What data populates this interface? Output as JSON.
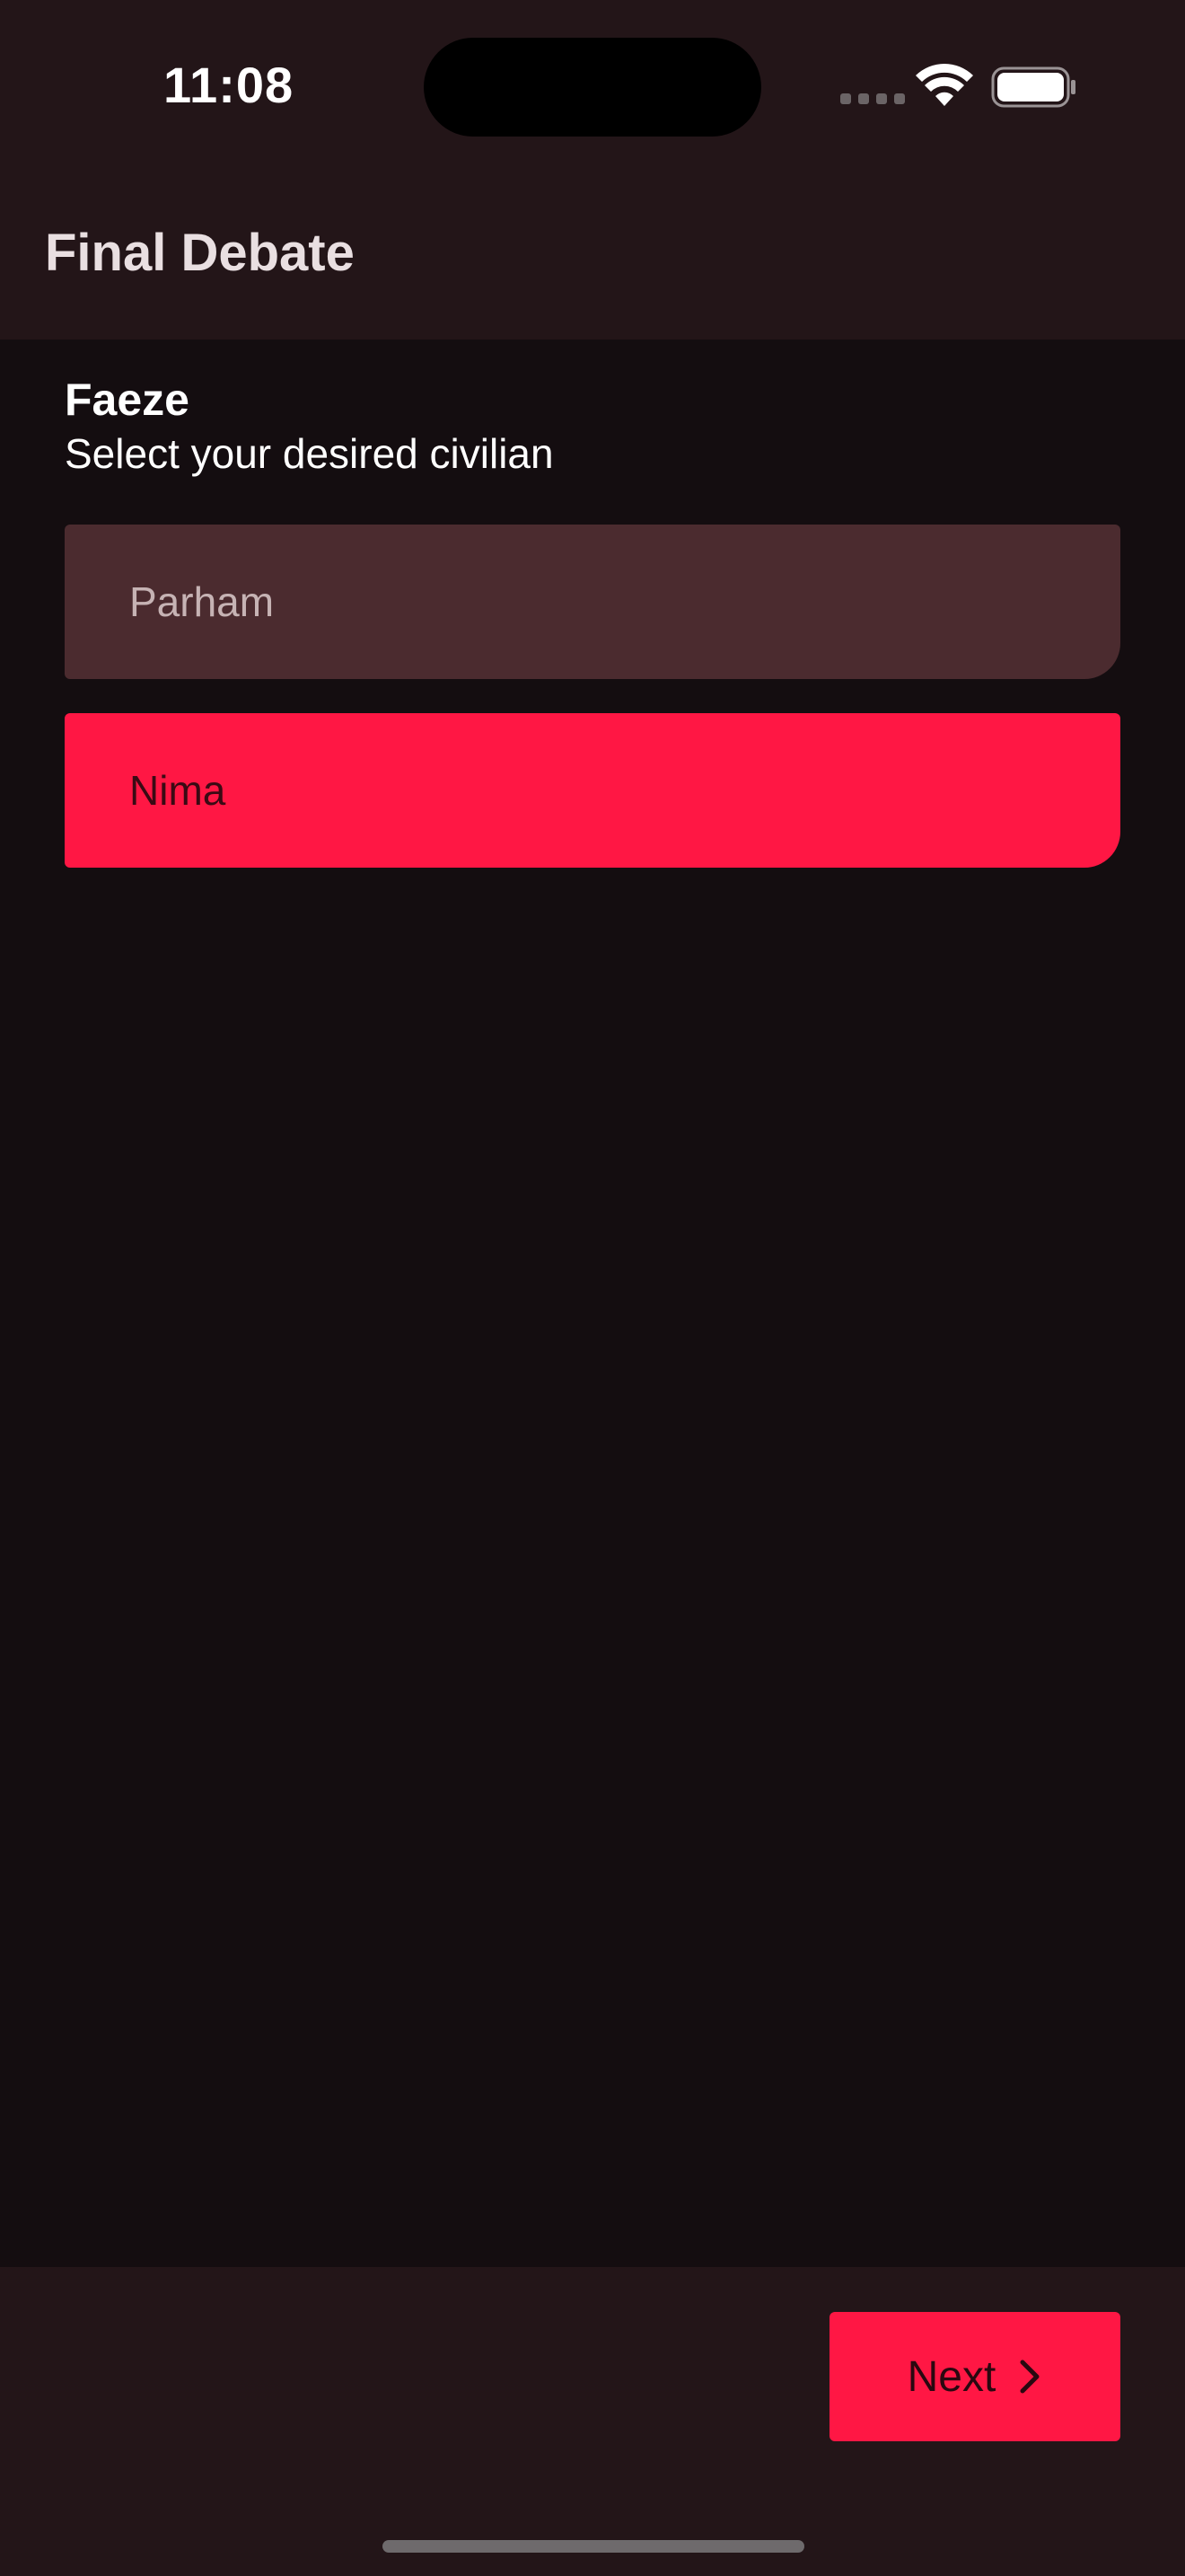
{
  "status_bar": {
    "time": "11:08",
    "icons": [
      "cellular-signal-icon",
      "wifi-icon",
      "battery-icon"
    ]
  },
  "app_bar": {
    "title": "Final Debate"
  },
  "main": {
    "player_name": "Faeze",
    "instruction": "Select your desired civilian",
    "options": [
      {
        "label": "Parham",
        "selected": false
      },
      {
        "label": "Nima",
        "selected": true
      }
    ]
  },
  "bottom_bar": {
    "next_label": "Next",
    "next_icon": "chevron-right-icon"
  },
  "colors": {
    "accent": "#ff1744",
    "surface": "#231518",
    "background": "#140d10",
    "option_unselected": "#4b2b2f"
  }
}
